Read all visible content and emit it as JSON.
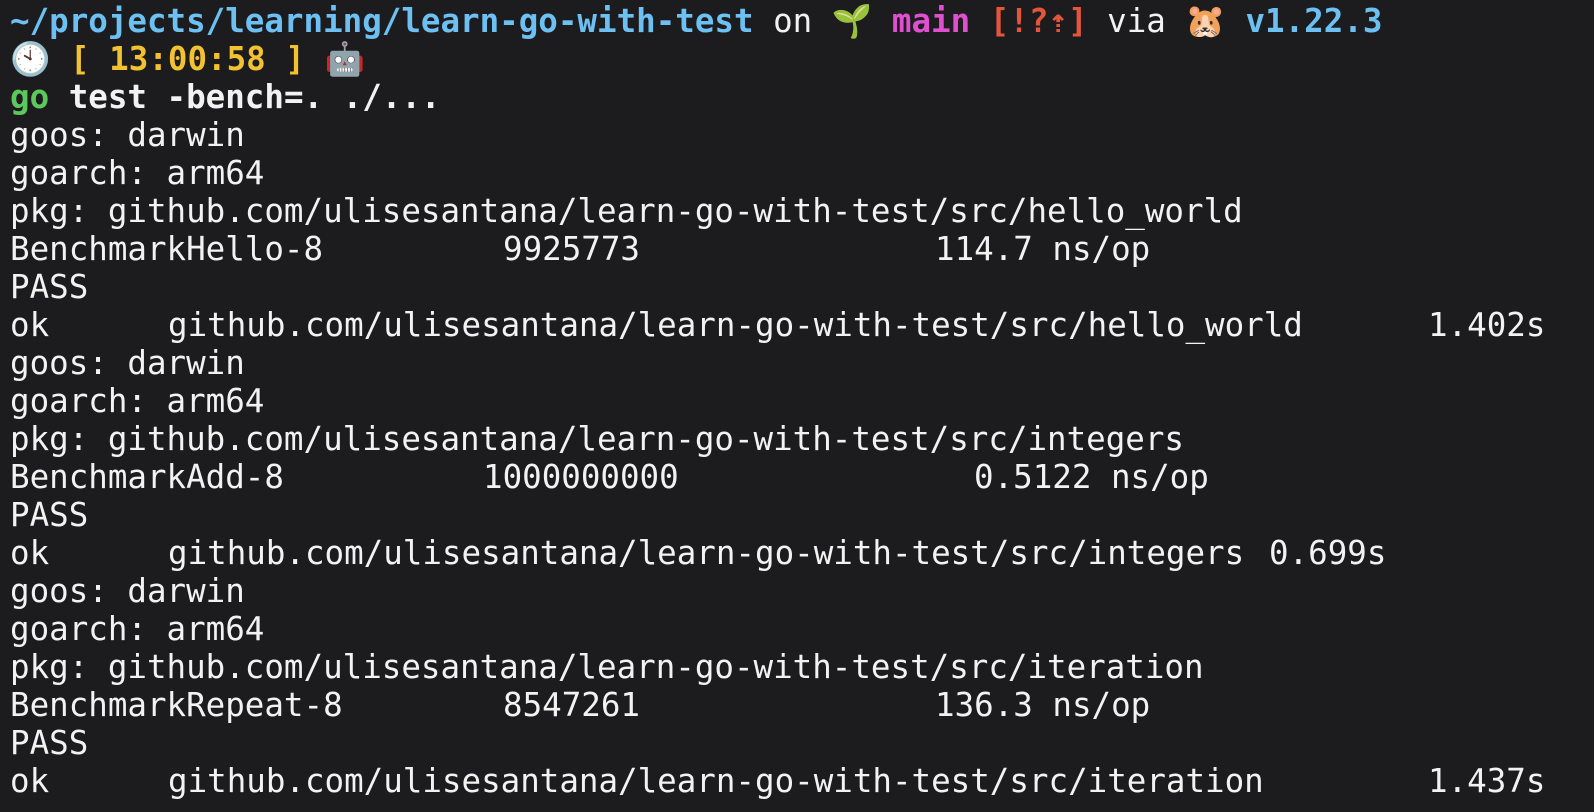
{
  "prompt": {
    "path": "~/projects/learning/learn-go-with-test",
    "on_word": " on ",
    "branch_icon": "🌱",
    "branch": "main",
    "git_status": "[!?⇡]",
    "via_word": " via ",
    "lang_icon": "🐹",
    "go_version": "v1.22.3",
    "clock_icon": "🕙",
    "time": "[ 13:00:58 ]",
    "robot_icon": "🤖"
  },
  "command": {
    "program": "go",
    "args": " test -bench=. ./..."
  },
  "blocks": [
    {
      "goos": "goos: darwin",
      "goarch": "goarch: arm64",
      "pkg": "pkg: github.com/ulisesantana/learn-go-with-test/src/hello_world",
      "bench_name": "BenchmarkHello-8",
      "bench_iters": "9925773",
      "bench_time": "114.7 ns/op",
      "pass": "PASS",
      "ok": "ok",
      "ok_pkg": "github.com/ulisesantana/learn-go-with-test/src/hello_world",
      "ok_time": "1.402s"
    },
    {
      "goos": "goos: darwin",
      "goarch": "goarch: arm64",
      "pkg": "pkg: github.com/ulisesantana/learn-go-with-test/src/integers",
      "bench_name": "BenchmarkAdd-8",
      "bench_iters": "1000000000",
      "bench_time": "0.5122 ns/op",
      "pass": "PASS",
      "ok": "ok",
      "ok_pkg": "github.com/ulisesantana/learn-go-with-test/src/integers",
      "ok_time": "0.699s"
    },
    {
      "goos": "goos: darwin",
      "goarch": "goarch: arm64",
      "pkg": "pkg: github.com/ulisesantana/learn-go-with-test/src/iteration",
      "bench_name": "BenchmarkRepeat-8",
      "bench_iters": "8547261",
      "bench_time": "136.3 ns/op",
      "pass": "PASS",
      "ok": "ok",
      "ok_pkg": "github.com/ulisesantana/learn-go-with-test/src/iteration",
      "ok_time": "1.437s"
    }
  ]
}
